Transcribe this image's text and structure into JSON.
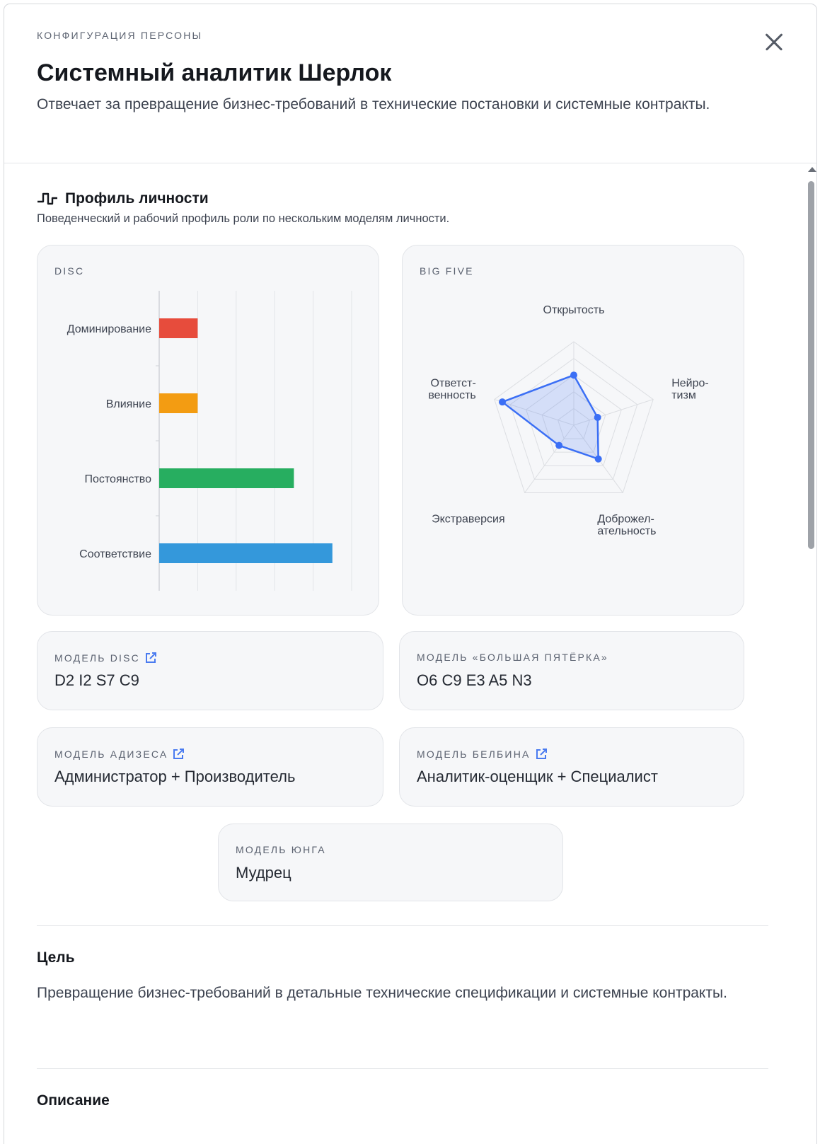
{
  "header": {
    "eyebrow": "КОНФИГУРАЦИЯ ПЕРСОНЫ",
    "title": "Системный аналитик Шерлок",
    "subtitle": "Отвечает за превращение бизнес-требований в технические постановки и системные контракты."
  },
  "profile": {
    "title": "Профиль личности",
    "description": "Поведенческий и рабочий профиль роли по нескольким моделям личности."
  },
  "disc_card": {
    "label": "DISC"
  },
  "bigfive_card": {
    "label": "BIG FIVE"
  },
  "chart_data": [
    {
      "type": "bar",
      "orientation": "horizontal",
      "title": "DISC",
      "categories": [
        "Доминирование",
        "Влияние",
        "Постоянство",
        "Соответствие"
      ],
      "values": [
        2,
        2,
        7,
        9
      ],
      "xlim": [
        0,
        10
      ],
      "colors": [
        "#e74c3c",
        "#f39c12",
        "#27ae60",
        "#3498db"
      ],
      "grid": true
    },
    {
      "type": "radar",
      "title": "BIG FIVE",
      "categories": [
        "Открытость",
        "Нейро-тизм",
        "Доброжел-ательность",
        "Экстраверсия",
        "Ответст-венность"
      ],
      "category_lines": [
        [
          "Открытость"
        ],
        [
          "Нейро-",
          "тизм"
        ],
        [
          "Доброжел-",
          "ательность"
        ],
        [
          "Экстраверсия"
        ],
        [
          "Ответст-",
          "венность"
        ]
      ],
      "values": [
        6,
        3,
        5,
        3,
        9
      ],
      "rmax": 10,
      "rings": 5,
      "color": "#3b6ff5"
    }
  ],
  "models": [
    {
      "label": "МОДЕЛЬ DISC",
      "value": "D2 I2 S7 C9",
      "link": true
    },
    {
      "label": "МОДЕЛЬ «БОЛЬШАЯ ПЯТЁРКА»",
      "value": "O6 C9 E3 A5 N3",
      "link": false
    },
    {
      "label": "МОДЕЛЬ АДИЗЕСА",
      "value": "Администратор + Производитель",
      "link": true
    },
    {
      "label": "МОДЕЛЬ БЕЛБИНА",
      "value": "Аналитик-оценщик + Специалист",
      "link": true
    },
    {
      "label": "МОДЕЛЬ ЮНГА",
      "value": "Мудрец",
      "link": false
    }
  ],
  "goal": {
    "title": "Цель",
    "text": "Превращение бизнес-требований в детальные технические спецификации и системные контракты."
  },
  "description": {
    "title": "Описание"
  }
}
